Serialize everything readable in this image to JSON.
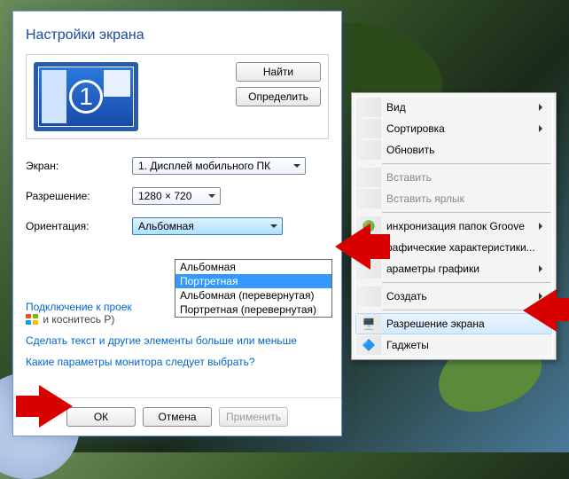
{
  "dialog": {
    "title": "Настройки экрана",
    "monitor_number": "1",
    "find_btn": "Найти",
    "identify_btn": "Определить",
    "fields": {
      "screen_label": "Экран:",
      "screen_value": "1. Дисплей мобильного ПК",
      "resolution_label": "Разрешение:",
      "resolution_value": "1280 × 720",
      "orientation_label": "Ориентация:",
      "orientation_value": "Альбомная"
    },
    "orientation_options": [
      "Альбомная",
      "Портретная",
      "Альбомная (перевернутая)",
      "Портретная (перевернутая)"
    ],
    "orientation_selected_index": 1,
    "links": {
      "projector_link": "Подключение к проек",
      "projector_tail": "и коснитесь P)",
      "text_size": "Сделать текст и другие элементы больше или меньше",
      "which_params": "Какие параметры монитора следует выбрать?"
    },
    "buttons": {
      "ok": "ОК",
      "cancel": "Отмена",
      "apply": "Применить"
    }
  },
  "context_menu": {
    "view": "Вид",
    "sort": "Сортировка",
    "refresh": "Обновить",
    "paste": "Вставить",
    "paste_shortcut": "Вставить ярлык",
    "groove": "инхронизация папок Groove",
    "graphics_props": "рафические характеристики...",
    "graphics_params": "араметры графики",
    "create": "Создать",
    "screen_resolution": "Разрешение экрана",
    "gadgets": "Гаджеты"
  }
}
